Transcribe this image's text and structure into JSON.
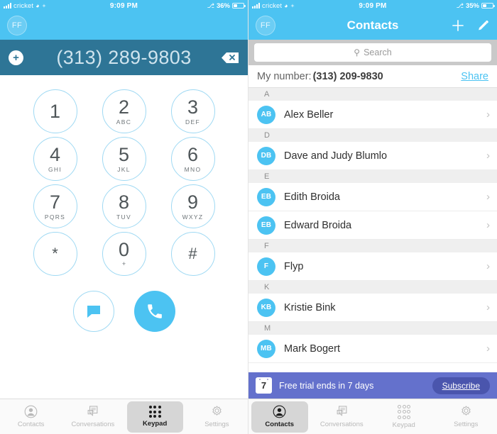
{
  "colors": {
    "accent": "#4cc3f2",
    "dialbar": "#2e7596",
    "banner": "#6471cc",
    "subscribe_button": "#4a55ad",
    "key_border": "#9fd9f3",
    "tab_active_bg": "#d6d6d6"
  },
  "keypad_screen": {
    "statusbar": {
      "carrier": "cricket",
      "wifi_icon": "wifi-icon",
      "location_icon": "location-icon",
      "time": "9:09 PM",
      "bluetooth_icon": "bluetooth-icon",
      "battery_percent": "36%",
      "battery_level": 36
    },
    "navbar": {
      "avatar_initials": "FF"
    },
    "dialbar": {
      "add_contact_icon": "plus-circle-icon",
      "number": "(313) 289-9803",
      "backspace_icon": "backspace-icon"
    },
    "keys": [
      {
        "digit": "1",
        "letters": ""
      },
      {
        "digit": "2",
        "letters": "ABC"
      },
      {
        "digit": "3",
        "letters": "DEF"
      },
      {
        "digit": "4",
        "letters": "GHI"
      },
      {
        "digit": "5",
        "letters": "JKL"
      },
      {
        "digit": "6",
        "letters": "MNO"
      },
      {
        "digit": "7",
        "letters": "PQRS"
      },
      {
        "digit": "8",
        "letters": "TUV"
      },
      {
        "digit": "9",
        "letters": "WXYZ"
      },
      {
        "digit": "*",
        "letters": ""
      },
      {
        "digit": "0",
        "letters": "+"
      },
      {
        "digit": "#",
        "letters": ""
      }
    ],
    "actions": {
      "message_icon": "message-bubble-icon",
      "call_icon": "phone-handset-icon"
    },
    "tabs": [
      {
        "label": "Contacts",
        "icon": "person-icon",
        "active": false
      },
      {
        "label": "Conversations",
        "icon": "chat-pages-icon",
        "active": false
      },
      {
        "label": "Keypad",
        "icon": "keypad-dots-icon",
        "active": true
      },
      {
        "label": "Settings",
        "icon": "gear-icon",
        "active": false
      }
    ]
  },
  "contacts_screen": {
    "statusbar": {
      "carrier": "cricket",
      "wifi_icon": "wifi-icon",
      "location_icon": "location-icon",
      "time": "9:09 PM",
      "bluetooth_icon": "bluetooth-icon",
      "battery_percent": "35%",
      "battery_level": 35
    },
    "navbar": {
      "avatar_initials": "FF",
      "title": "Contacts",
      "add_icon": "plus-icon",
      "edit_icon": "pencil-icon"
    },
    "search": {
      "placeholder": "Search",
      "value": "",
      "icon": "search-icon"
    },
    "my_number": {
      "label": "My number:",
      "value": "(313) 209-9830",
      "share_label": "Share"
    },
    "sections": [
      {
        "letter": "A",
        "contacts": [
          {
            "initials": "AB",
            "name": "Alex Beller"
          }
        ]
      },
      {
        "letter": "D",
        "contacts": [
          {
            "initials": "DB",
            "name": "Dave and Judy Blumlo"
          }
        ]
      },
      {
        "letter": "E",
        "contacts": [
          {
            "initials": "EB",
            "name": "Edith Broida"
          },
          {
            "initials": "EB",
            "name": "Edward Broida"
          }
        ]
      },
      {
        "letter": "F",
        "contacts": [
          {
            "initials": "F",
            "name": "Flyp"
          }
        ]
      },
      {
        "letter": "K",
        "contacts": [
          {
            "initials": "KB",
            "name": "Kristie Bink"
          }
        ]
      },
      {
        "letter": "M",
        "contacts": [
          {
            "initials": "MB",
            "name": "Mark Bogert"
          }
        ]
      }
    ],
    "trial_banner": {
      "calendar_day": "7",
      "text": "Free trial ends in 7 days",
      "subscribe_label": "Subscribe"
    },
    "tabs": [
      {
        "label": "Contacts",
        "icon": "person-icon",
        "active": true
      },
      {
        "label": "Conversations",
        "icon": "chat-pages-icon",
        "active": false
      },
      {
        "label": "Keypad",
        "icon": "keypad-dots-icon",
        "active": false
      },
      {
        "label": "Settings",
        "icon": "gear-icon",
        "active": false
      }
    ]
  }
}
